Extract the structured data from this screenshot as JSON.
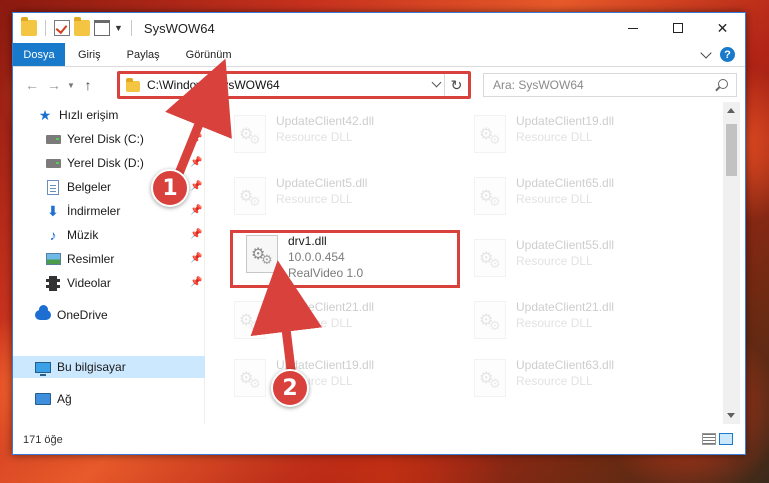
{
  "window": {
    "title": "SysWOW64"
  },
  "ribbon": {
    "tabs": [
      "Dosya",
      "Giriş",
      "Paylaş",
      "Görünüm"
    ]
  },
  "address": {
    "path": "C:\\Windows\\SysWOW64"
  },
  "search": {
    "placeholder": "Ara: SysWOW64"
  },
  "sidebar": {
    "items": [
      {
        "label": "Hızlı erişim",
        "icon": "star-icon"
      },
      {
        "label": "Yerel Disk (C:)",
        "icon": "drive-icon",
        "pinned": true
      },
      {
        "label": "Yerel Disk (D:)",
        "icon": "drive-icon",
        "pinned": true
      },
      {
        "label": "Belgeler",
        "icon": "documents-icon",
        "pinned": true
      },
      {
        "label": "İndirmeler",
        "icon": "downloads-icon",
        "pinned": true
      },
      {
        "label": "Müzik",
        "icon": "music-icon",
        "pinned": true
      },
      {
        "label": "Resimler",
        "icon": "pictures-icon",
        "pinned": true
      },
      {
        "label": "Videolar",
        "icon": "videos-icon",
        "pinned": true
      },
      {
        "label": "OneDrive",
        "icon": "onedrive-icon"
      },
      {
        "label": "Bu bilgisayar",
        "icon": "this-pc-icon",
        "selected": true
      },
      {
        "label": "Ağ",
        "icon": "network-icon"
      }
    ]
  },
  "files": [
    {
      "name": "UpdateClient42.dll",
      "desc": "Resource DLL",
      "faded": true
    },
    {
      "name": "UpdateClient19.dll",
      "desc": "Resource DLL",
      "faded": true
    },
    {
      "name": "UpdateClient5.dll",
      "desc": "Resource DLL",
      "faded": true
    },
    {
      "name": "UpdateClient65.dll",
      "desc": "Resource DLL",
      "faded": true
    },
    {
      "name": "drv1.dll",
      "version": "10.0.0.454",
      "desc": "RealVideo 1.0",
      "faded": false
    },
    {
      "name": "UpdateClient55.dll",
      "desc": "Resource DLL",
      "faded": true
    },
    {
      "name": "UpdateClient21.dll",
      "desc": "Resource DLL",
      "faded": true
    },
    {
      "name": "UpdateClient21.dll",
      "desc": "Resource DLL",
      "faded": true
    },
    {
      "name": "UpdateClient19.dll",
      "desc": "Resource DLL",
      "faded": true
    },
    {
      "name": "UpdateClient63.dll",
      "desc": "Resource DLL",
      "faded": true
    }
  ],
  "status": {
    "count": "171 öğe"
  },
  "callouts": [
    {
      "number": "1"
    },
    {
      "number": "2"
    }
  ],
  "colors": {
    "accent": "#1979ca",
    "highlight": "#d8413c",
    "selected": "#cce8ff"
  }
}
